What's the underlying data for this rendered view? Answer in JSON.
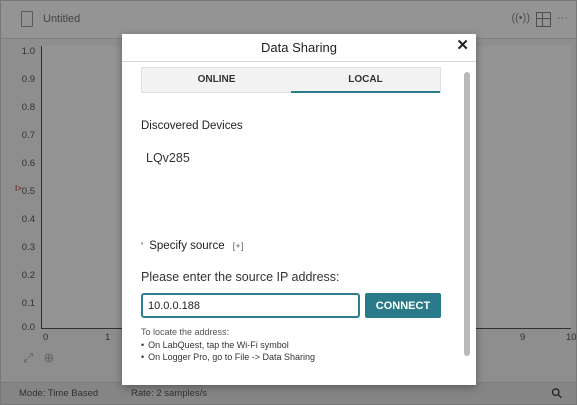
{
  "app": {
    "document_title": "Untitled",
    "y_ticks": [
      "1.0",
      "0.9",
      "0.8",
      "0.7",
      "0.6",
      "0.5",
      "0.4",
      "0.3",
      "0.2",
      "0.1",
      "0.0"
    ],
    "x_ticks": [
      "0",
      "1",
      "9",
      "10"
    ],
    "status_mode": "Mode: Time Based",
    "status_rate": "Rate: 2 samples/s"
  },
  "modal": {
    "title": "Data Sharing",
    "tabs": [
      {
        "label": "ONLINE",
        "active": false
      },
      {
        "label": "LOCAL",
        "active": true
      }
    ],
    "discovered_title": "Discovered Devices",
    "devices": [
      "LQv285"
    ],
    "specify_label": "Specify source",
    "expand_label": "[+]",
    "prompt": "Please enter the source IP address:",
    "ip_value": "10.0.0.188",
    "connect_label": "CONNECT",
    "hint_title": "To locate the address:",
    "hints": [
      "On LabQuest, tap the Wi-Fi symbol",
      "On Logger Pro, go to File -> Data Sharing"
    ]
  },
  "colors": {
    "accent": "#2b7a89",
    "overlay": "rgba(0,0,0,0.42)"
  }
}
